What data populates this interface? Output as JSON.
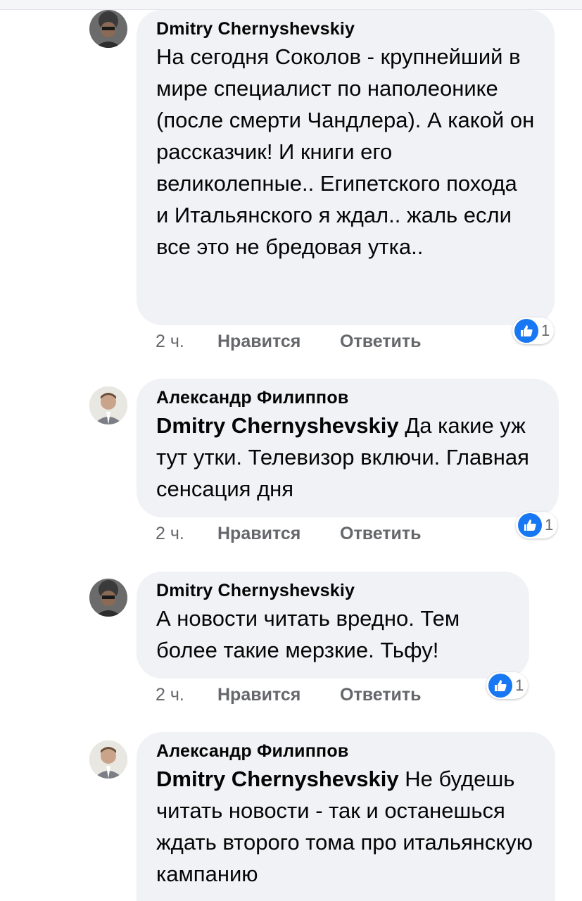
{
  "comments": [
    {
      "author": "Dmitry Chernyshevskiy",
      "mention": "",
      "text": "На сегодня Соколов - крупнейший в мире специалист по наполеонике (после смерти Чандлера). А какой он рассказчик! И книги его великолепные.. Египетского похода и Итальянского я ждал.. жаль если все это не бредовая утка..",
      "time": "2 ч.",
      "like_label": "Нравится",
      "reply_label": "Ответить",
      "reactions": "1"
    },
    {
      "author": "Александр Филиппов",
      "mention": "Dmitry Chernyshevskiy",
      "text": "Да какие уж тут утки. Телевизор включи. Главная сенсация дня",
      "time": "2 ч.",
      "like_label": "Нравится",
      "reply_label": "Ответить",
      "reactions": "1"
    },
    {
      "author": "Dmitry Chernyshevskiy",
      "mention": "",
      "text": "А новости читать вредно. Тем более такие мерзкие. Тьфу!",
      "time": "2 ч.",
      "like_label": "Нравится",
      "reply_label": "Ответить",
      "reactions": "1"
    },
    {
      "author": "Александр Филиппов",
      "mention": "Dmitry Chernyshevskiy",
      "text": "Не будешь читать новости - так и останешься ждать второго тома про итальянскую кампанию"
    }
  ],
  "colors": {
    "bubble": "#f0f2f5",
    "meta": "#65676b",
    "like_blue": "#1877f2"
  }
}
